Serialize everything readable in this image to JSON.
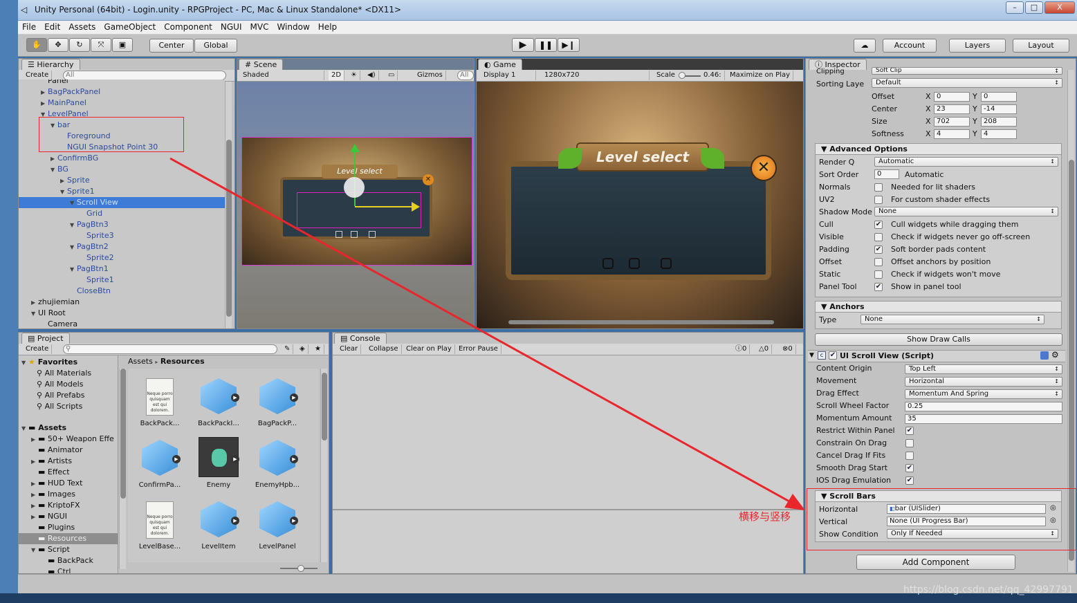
{
  "window": {
    "title": "Unity Personal (64bit) - Login.unity - RPGProject - PC, Mac & Linux Standalone* <DX11>",
    "minimize": "–",
    "maximize": "□",
    "close": "X"
  },
  "menu": [
    "File",
    "Edit",
    "Assets",
    "GameObject",
    "Component",
    "NGUI",
    "MVC",
    "Window",
    "Help"
  ],
  "toolbar": {
    "pivot": "Center",
    "space": "Global",
    "account": "Account",
    "layers": "Layers",
    "layout": "Layout"
  },
  "hierarchy": {
    "tab": "Hierarchy",
    "create": "Create",
    "search": "All",
    "items": [
      {
        "label": "Panel",
        "indent": 0,
        "arrow": "",
        "color": "dark",
        "selected": false
      },
      {
        "label": "BagPackPanel",
        "indent": 0,
        "arrow": "▶",
        "color": "blue",
        "selected": false
      },
      {
        "label": "MainPanel",
        "indent": 0,
        "arrow": "▶",
        "color": "blue",
        "selected": false
      },
      {
        "label": "LevelPanel",
        "indent": 0,
        "arrow": "▼",
        "color": "blue",
        "selected": false
      },
      {
        "label": "bar",
        "indent": 1,
        "arrow": "▼",
        "color": "blue",
        "selected": false
      },
      {
        "label": "Foreground",
        "indent": 2,
        "arrow": "",
        "color": "blue",
        "selected": false
      },
      {
        "label": "NGUI Snapshot Point 30",
        "indent": 2,
        "arrow": "",
        "color": "blue",
        "selected": false
      },
      {
        "label": "ConfirmBG",
        "indent": 1,
        "arrow": "▶",
        "color": "blue",
        "selected": false
      },
      {
        "label": "BG",
        "indent": 1,
        "arrow": "▼",
        "color": "blue",
        "selected": false
      },
      {
        "label": "Sprite",
        "indent": 2,
        "arrow": "▶",
        "color": "blue",
        "selected": false
      },
      {
        "label": "Sprite1",
        "indent": 2,
        "arrow": "▼",
        "color": "blue",
        "selected": false
      },
      {
        "label": "Scroll View",
        "indent": 3,
        "arrow": "▼",
        "color": "blue",
        "selected": true
      },
      {
        "label": "Grid",
        "indent": 4,
        "arrow": "",
        "color": "blue",
        "selected": false
      },
      {
        "label": "PagBtn3",
        "indent": 3,
        "arrow": "▼",
        "color": "blue",
        "selected": false
      },
      {
        "label": "Sprite3",
        "indent": 4,
        "arrow": "",
        "color": "blue",
        "selected": false
      },
      {
        "label": "PagBtn2",
        "indent": 3,
        "arrow": "▼",
        "color": "blue",
        "selected": false
      },
      {
        "label": "Sprite2",
        "indent": 4,
        "arrow": "",
        "color": "blue",
        "selected": false
      },
      {
        "label": "PagBtn1",
        "indent": 3,
        "arrow": "▼",
        "color": "blue",
        "selected": false
      },
      {
        "label": "Sprite1",
        "indent": 4,
        "arrow": "",
        "color": "blue",
        "selected": false
      },
      {
        "label": "CloseBtn",
        "indent": 3,
        "arrow": "",
        "color": "blue",
        "selected": false
      },
      {
        "label": "zhujiemian",
        "indent": -1,
        "arrow": "▶",
        "color": "dark",
        "selected": false
      },
      {
        "label": "UI Root",
        "indent": -1,
        "arrow": "▼",
        "color": "dark",
        "selected": false
      },
      {
        "label": "Camera",
        "indent": 0,
        "arrow": "",
        "color": "dark",
        "selected": false
      }
    ]
  },
  "scene": {
    "tab": "Scene",
    "shading": "Shaded",
    "mode2d": "2D",
    "gizmos": "Gizmos",
    "search": "All",
    "title_text": "Level select"
  },
  "game": {
    "tab": "Game",
    "display": "Display 1",
    "resolution": "1280x720",
    "scale_label": "Scale",
    "scale_value": "0.46:",
    "maximize": "Maximize on Play",
    "title_text": "Level select"
  },
  "inspector": {
    "tab": "Inspector",
    "clipping_label": "Clipping",
    "clipping_value": "Soft Clip",
    "sorting_label": "Sorting Laye",
    "sorting_value": "Default",
    "vec_rows": [
      {
        "label": "Offset",
        "x": "0",
        "y": "0"
      },
      {
        "label": "Center",
        "x": "23",
        "y": "-14"
      },
      {
        "label": "Size",
        "x": "702",
        "y": "208"
      },
      {
        "label": "Softness",
        "x": "4",
        "y": "4"
      }
    ],
    "x_label": "X",
    "y_label": "Y",
    "advanced_header": "Advanced Options",
    "render_q_label": "Render Q",
    "render_q_value": "Automatic",
    "sort_order_label": "Sort Order",
    "sort_order_value": "0",
    "sort_order_note": "Automatic",
    "options": [
      {
        "label": "Normals",
        "checked": false,
        "desc": "Needed for lit shaders"
      },
      {
        "label": "UV2",
        "checked": false,
        "desc": "For custom shader effects"
      }
    ],
    "shadow_label": "Shadow Mode",
    "shadow_value": "None",
    "options2": [
      {
        "label": "Cull",
        "checked": true,
        "desc": "Cull widgets while dragging them"
      },
      {
        "label": "Visible",
        "checked": false,
        "desc": "Check if widgets never go off-screen"
      },
      {
        "label": "Padding",
        "checked": true,
        "desc": "Soft border pads content"
      },
      {
        "label": "Offset",
        "checked": false,
        "desc": "Offset anchors by position"
      },
      {
        "label": "Static",
        "checked": false,
        "desc": "Check if widgets won't move"
      },
      {
        "label": "Panel Tool",
        "checked": true,
        "desc": "Show in panel tool"
      }
    ],
    "anchors_header": "Anchors",
    "type_label": "Type",
    "type_value": "None",
    "show_draw_calls": "Show Draw Calls",
    "component_title": "UI Scroll View (Script)",
    "sv_rows": [
      {
        "label": "Content Origin",
        "kind": "dd",
        "value": "Top Left"
      },
      {
        "label": "Movement",
        "kind": "dd",
        "value": "Horizontal"
      },
      {
        "label": "Drag Effect",
        "kind": "dd",
        "value": "Momentum And Spring"
      },
      {
        "label": "Scroll Wheel Factor",
        "kind": "field",
        "value": "0.25"
      },
      {
        "label": "Momentum Amount",
        "kind": "field",
        "value": "35"
      },
      {
        "label": "Restrict Within Panel",
        "kind": "cb",
        "checked": true
      },
      {
        "label": "Constrain On Drag",
        "kind": "cb",
        "checked": false
      },
      {
        "label": "Cancel Drag If Fits",
        "kind": "cb",
        "checked": false
      },
      {
        "label": "Smooth Drag Start",
        "kind": "cb",
        "checked": true
      },
      {
        "label": "IOS Drag Emulation",
        "kind": "cb",
        "checked": true
      }
    ],
    "scrollbars_header": "Scroll Bars",
    "horizontal_label": "Horizontal",
    "horizontal_value": "bar (UISlider)",
    "vertical_label": "Vertical",
    "vertical_value": "None (UI Progress Bar)",
    "show_condition_label": "Show Condition",
    "show_condition_value": "Only If Needed",
    "add_component": "Add Component"
  },
  "project": {
    "tab": "Project",
    "create": "Create",
    "favorites_header": "Favorites",
    "favorites": [
      "All Materials",
      "All Models",
      "All Prefabs",
      "All Scripts"
    ],
    "assets_header": "Assets",
    "folders": [
      {
        "label": "50+ Weapon Effe",
        "indent": 1,
        "arrow": "▶",
        "selected": false
      },
      {
        "label": "Animator",
        "indent": 1,
        "arrow": "",
        "selected": false
      },
      {
        "label": "Artists",
        "indent": 1,
        "arrow": "▶",
        "selected": false
      },
      {
        "label": "Effect",
        "indent": 1,
        "arrow": "",
        "selected": false
      },
      {
        "label": "HUD Text",
        "indent": 1,
        "arrow": "▶",
        "selected": false
      },
      {
        "label": "Images",
        "indent": 1,
        "arrow": "▶",
        "selected": false
      },
      {
        "label": "KriptoFX",
        "indent": 1,
        "arrow": "▶",
        "selected": false
      },
      {
        "label": "NGUI",
        "indent": 1,
        "arrow": "▶",
        "selected": false
      },
      {
        "label": "Plugins",
        "indent": 1,
        "arrow": "",
        "selected": false
      },
      {
        "label": "Resources",
        "indent": 1,
        "arrow": "",
        "selected": true
      },
      {
        "label": "Script",
        "indent": 1,
        "arrow": "▼",
        "selected": false
      },
      {
        "label": "BackPack",
        "indent": 2,
        "arrow": "",
        "selected": false
      },
      {
        "label": "Ctrl",
        "indent": 2,
        "arrow": "",
        "selected": false
      }
    ],
    "breadcrumb_root": "Assets",
    "breadcrumb_sep": "▸",
    "breadcrumb_current": "Resources",
    "doc_text": "Neque porro quisquam est qui dolorem.",
    "assets": [
      {
        "name": "BackPack...",
        "kind": "doc"
      },
      {
        "name": "BackPackI...",
        "kind": "cube"
      },
      {
        "name": "BagPackP...",
        "kind": "cube"
      },
      {
        "name": "ConfirmPa...",
        "kind": "cube"
      },
      {
        "name": "Enemy",
        "kind": "enemy"
      },
      {
        "name": "EnemyHpb...",
        "kind": "cube"
      },
      {
        "name": "LevelBase...",
        "kind": "doc"
      },
      {
        "name": "LevelItem",
        "kind": "cube"
      },
      {
        "name": "LevelPanel",
        "kind": "cube"
      }
    ]
  },
  "console": {
    "tab": "Console",
    "buttons": [
      "Clear",
      "Collapse",
      "Clear on Play",
      "Error Pause"
    ],
    "counts": [
      "0",
      "0",
      "0"
    ]
  },
  "annotation": {
    "text": "横移与竖移",
    "color": "#e8262b"
  },
  "watermark": "https://blog.csdn.net/qq_42997791"
}
